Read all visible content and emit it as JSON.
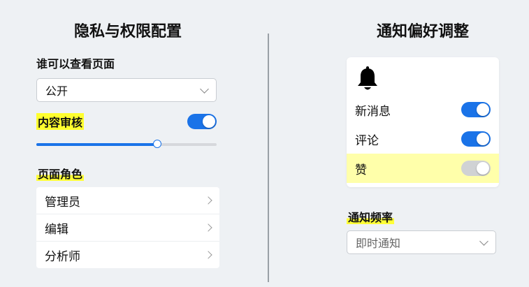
{
  "privacy": {
    "title": "隐私与权限配置",
    "visibility_label": "谁可以查看页面",
    "visibility_value": "公开",
    "moderation_label": "内容审核",
    "moderation_on": true,
    "moderation_level": 0.67,
    "roles_label": "页面角色",
    "roles": [
      {
        "label": "管理员"
      },
      {
        "label": "编辑"
      },
      {
        "label": "分析师"
      }
    ]
  },
  "notifications": {
    "title": "通知偏好调整",
    "items": [
      {
        "label": "新消息",
        "on": true
      },
      {
        "label": "评论",
        "on": true
      },
      {
        "label": "赞",
        "on": false
      }
    ],
    "frequency_label": "通知频率",
    "frequency_value": "即时通知"
  },
  "colors": {
    "accent": "#1a73e8",
    "highlight": "#ffff2e"
  }
}
